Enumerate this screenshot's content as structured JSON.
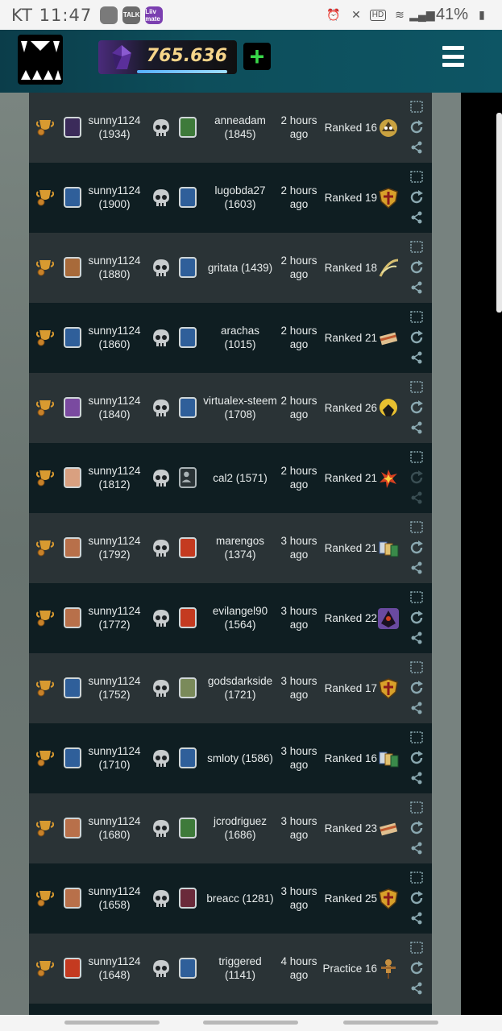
{
  "status_bar": {
    "carrier": "KT",
    "time": "11:47",
    "app_icons": [
      {
        "name": "feather-icon",
        "label": "",
        "color": "#7a7a7a"
      },
      {
        "name": "talk-icon",
        "label": "TALK",
        "color": "#6b6b6b"
      },
      {
        "name": "liiv-mate-icon",
        "label": "Liiv mate",
        "color": "#7b3fb0"
      }
    ],
    "battery": "41%"
  },
  "header": {
    "credits_value": "765.636",
    "add_label": "+"
  },
  "battles": [
    {
      "player": "sunny1124",
      "player_rating": "(1934)",
      "player_avatar": "#3b2b5a",
      "opponent_name": "anneadam",
      "opponent_rating": "(1845)",
      "opponent_avatar": "#3e7a3a",
      "time_value": "2 hours",
      "time_unit": "ago",
      "mode": "Ranked 16",
      "game_mode_icon": "owl-icon",
      "game_mode_color": "#c9a240"
    },
    {
      "player": "sunny1124",
      "player_rating": "(1900)",
      "player_avatar": "#2f5f9a",
      "opponent_name": "lugobda27",
      "opponent_rating": "(1603)",
      "opponent_avatar": "#2f5f9a",
      "time_value": "2 hours",
      "time_unit": "ago",
      "mode": "Ranked 19",
      "game_mode_icon": "shield-icon",
      "game_mode_color": "#d8a02a"
    },
    {
      "player": "sunny1124",
      "player_rating": "(1880)",
      "player_avatar": "#a86a3a",
      "opponent_name": "gritata (1439)",
      "opponent_rating": "",
      "opponent_avatar": "#2f5f9a",
      "time_value": "2 hours",
      "time_unit": "ago",
      "mode": "Ranked 18",
      "game_mode_icon": "swords-icon",
      "game_mode_color": "#d8c070"
    },
    {
      "player": "sunny1124",
      "player_rating": "(1860)",
      "player_avatar": "#2f5f9a",
      "opponent_name": "arachas",
      "opponent_rating": "(1015)",
      "opponent_avatar": "#2f5f9a",
      "time_value": "2 hours",
      "time_unit": "ago",
      "mode": "Ranked 21",
      "game_mode_icon": "scroll-icon",
      "game_mode_color": "#c05a30"
    },
    {
      "player": "sunny1124",
      "player_rating": "(1840)",
      "player_avatar": "#7a4aa0",
      "opponent_name": "virtualex-steem",
      "opponent_rating": "(1708)",
      "opponent_avatar": "#2f5f9a",
      "time_value": "2 hours",
      "time_unit": "ago",
      "mode": "Ranked 26",
      "game_mode_icon": "creature-icon",
      "game_mode_color": "#e8c030"
    },
    {
      "player": "sunny1124",
      "player_rating": "(1812)",
      "player_avatar": "#d9a080",
      "opponent_name": "cal2 (1571)",
      "opponent_rating": "",
      "opponent_avatar": "",
      "time_value": "2 hours",
      "time_unit": "ago",
      "mode": "Ranked 21",
      "game_mode_icon": "explosion-icon",
      "game_mode_color": "#d84020"
    },
    {
      "player": "sunny1124",
      "player_rating": "(1792)",
      "player_avatar": "#b8704a",
      "opponent_name": "marengos",
      "opponent_rating": "(1374)",
      "opponent_avatar": "#c43a20",
      "time_value": "3 hours",
      "time_unit": "ago",
      "mode": "Ranked 21",
      "game_mode_icon": "cards-icon",
      "game_mode_color": "#3a8a4a"
    },
    {
      "player": "sunny1124",
      "player_rating": "(1772)",
      "player_avatar": "#b8704a",
      "opponent_name": "evilangel90",
      "opponent_rating": "(1564)",
      "opponent_avatar": "#c43a20",
      "time_value": "3 hours",
      "time_unit": "ago",
      "mode": "Ranked 22",
      "game_mode_icon": "hooded-figure-icon",
      "game_mode_color": "#6a4aa0"
    },
    {
      "player": "sunny1124",
      "player_rating": "(1752)",
      "player_avatar": "#2f5f9a",
      "opponent_name": "godsdarkside",
      "opponent_rating": "(1721)",
      "opponent_avatar": "#7a8a5a",
      "time_value": "3 hours",
      "time_unit": "ago",
      "mode": "Ranked 17",
      "game_mode_icon": "shield-icon",
      "game_mode_color": "#d8a02a"
    },
    {
      "player": "sunny1124",
      "player_rating": "(1710)",
      "player_avatar": "#2f5f9a",
      "opponent_name": "smloty (1586)",
      "opponent_rating": "",
      "opponent_avatar": "#2f5f9a",
      "time_value": "3 hours",
      "time_unit": "ago",
      "mode": "Ranked 16",
      "game_mode_icon": "cards-icon",
      "game_mode_color": "#3a8a4a"
    },
    {
      "player": "sunny1124",
      "player_rating": "(1680)",
      "player_avatar": "#b8704a",
      "opponent_name": "jcrodriguez",
      "opponent_rating": "(1686)",
      "opponent_avatar": "#3e7a3a",
      "time_value": "3 hours",
      "time_unit": "ago",
      "mode": "Ranked 23",
      "game_mode_icon": "scroll-icon",
      "game_mode_color": "#c05a30"
    },
    {
      "player": "sunny1124",
      "player_rating": "(1658)",
      "player_avatar": "#b8704a",
      "opponent_name": "breacc (1281)",
      "opponent_rating": "",
      "opponent_avatar": "#6a2a3a",
      "time_value": "3 hours",
      "time_unit": "ago",
      "mode": "Ranked 25",
      "game_mode_icon": "shield-icon",
      "game_mode_color": "#d8a02a"
    },
    {
      "player": "sunny1124",
      "player_rating": "(1648)",
      "player_avatar": "#c43a20",
      "opponent_name": "triggered",
      "opponent_rating": "(1141)",
      "opponent_avatar": "#2f5f9a",
      "time_value": "4 hours",
      "time_unit": "ago",
      "mode": "Practice 16",
      "game_mode_icon": "practice-dummy-icon",
      "game_mode_color": "#c89040"
    }
  ]
}
